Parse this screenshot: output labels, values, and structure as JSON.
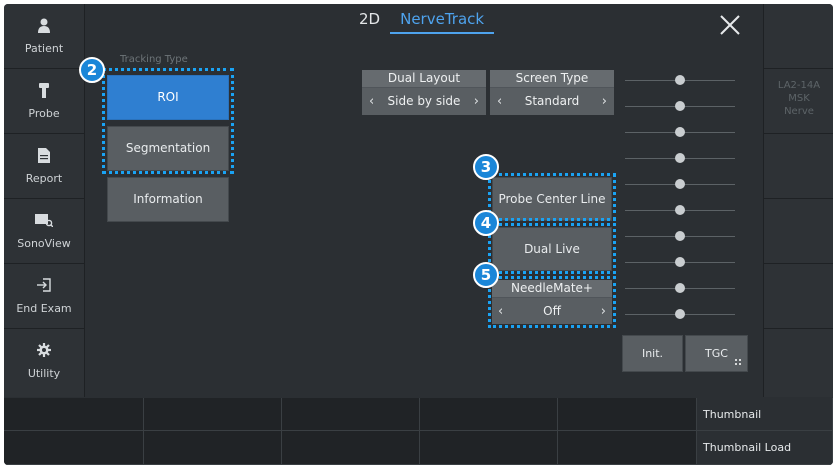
{
  "sidebar": {
    "items": [
      {
        "label": "Patient",
        "icon": "person-icon"
      },
      {
        "label": "Probe",
        "icon": "probe-icon"
      },
      {
        "label": "Report",
        "icon": "document-icon"
      },
      {
        "label": "SonoView",
        "icon": "sonoview-icon"
      },
      {
        "label": "End Exam",
        "icon": "exit-icon"
      },
      {
        "label": "Utility",
        "icon": "gear-icon"
      }
    ]
  },
  "header": {
    "tabs": [
      {
        "label": "2D",
        "active": false
      },
      {
        "label": "NerveTrack",
        "active": true
      }
    ]
  },
  "tracking": {
    "label": "Tracking Type",
    "roi": "ROI",
    "segmentation": "Segmentation",
    "information": "Information"
  },
  "dual_layout": {
    "title": "Dual Layout",
    "value": "Side by side"
  },
  "screen_type": {
    "title": "Screen Type",
    "value": "Standard"
  },
  "probe_center_line": "Probe Center Line",
  "dual_live": "Dual Live",
  "needlemate": {
    "title": "NeedleMate+",
    "value": "Off"
  },
  "badges": [
    "2",
    "3",
    "4",
    "5"
  ],
  "tgc": {
    "init": "Init.",
    "tgc": "TGC",
    "levels": [
      0.5,
      0.5,
      0.5,
      0.5,
      0.5,
      0.5,
      0.5,
      0.5,
      0.5,
      0.5
    ]
  },
  "probe_info": {
    "model": "LA2-14A",
    "preset1": "MSK",
    "preset2": "Nerve"
  },
  "bottom": {
    "thumbnail": "Thumbnail",
    "thumbnail_load": "Thumbnail Load"
  },
  "colors": {
    "accent": "#2f7fd1",
    "highlight": "#1aa3f4",
    "tab_active": "#4ea3ee"
  }
}
